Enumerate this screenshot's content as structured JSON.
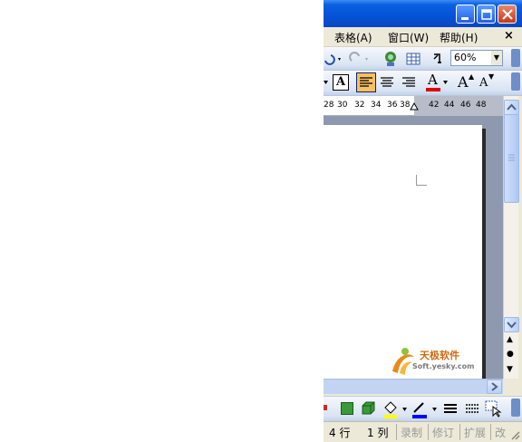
{
  "menu": {
    "items": [
      "表格(A)",
      "窗口(W)",
      "帮助(H)"
    ],
    "close": "×"
  },
  "toolbar_standard": {
    "zoom": "60%"
  },
  "toolbar_format": {
    "font_color_letter": "A",
    "grow_font": "A",
    "shrink_font": "A",
    "char_border": "A"
  },
  "ruler": {
    "numbers": [
      "28",
      "30",
      "32",
      "34",
      "36",
      "38",
      "42",
      "44",
      "46",
      "48"
    ]
  },
  "watermark": {
    "name": "天极软件",
    "url": "Soft.yesky.com"
  },
  "status": {
    "line": "4 行",
    "col": "1 列",
    "rec": "录制",
    "trk": "修订",
    "ext": "扩展",
    "ovr": "改"
  },
  "colors": {
    "titlebar": "#0552d6",
    "font_color_red": "#e00000",
    "highlight_yellow": "#ffff00",
    "align_active": "#f7c062"
  },
  "icons": [
    "minimize-icon",
    "maximize-icon",
    "close-icon",
    "undo-icon",
    "redo-icon",
    "hyperlink-icon",
    "table-icon",
    "paragraph-icon",
    "align-left-icon",
    "align-center-icon",
    "align-right-icon",
    "font-color-icon",
    "grow-font-icon",
    "shrink-font-icon",
    "shadow-icon",
    "3d-icon",
    "fill-color-icon",
    "line-color-icon",
    "line-style-icon",
    "dash-style-icon",
    "select-object-icon"
  ]
}
